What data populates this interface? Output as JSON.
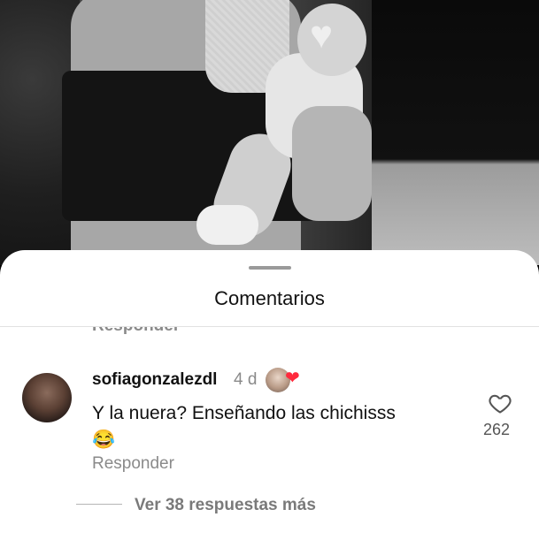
{
  "sheet": {
    "title": "Comentarios"
  },
  "previous_comment": {
    "reply_label": "Responder"
  },
  "comment": {
    "username": "sofiagonzalezdl",
    "time": "4 d",
    "text": "Y la nuera? Enseñando las chichisss",
    "emoji": "😂",
    "like_count": "262",
    "reply_label": "Responder",
    "view_replies": "Ver 38 respuestas más",
    "liked_by_author_heart": "❤"
  },
  "colors": {
    "like_heart_red": "#ff2a3d",
    "sheet_bg": "#ffffff"
  }
}
